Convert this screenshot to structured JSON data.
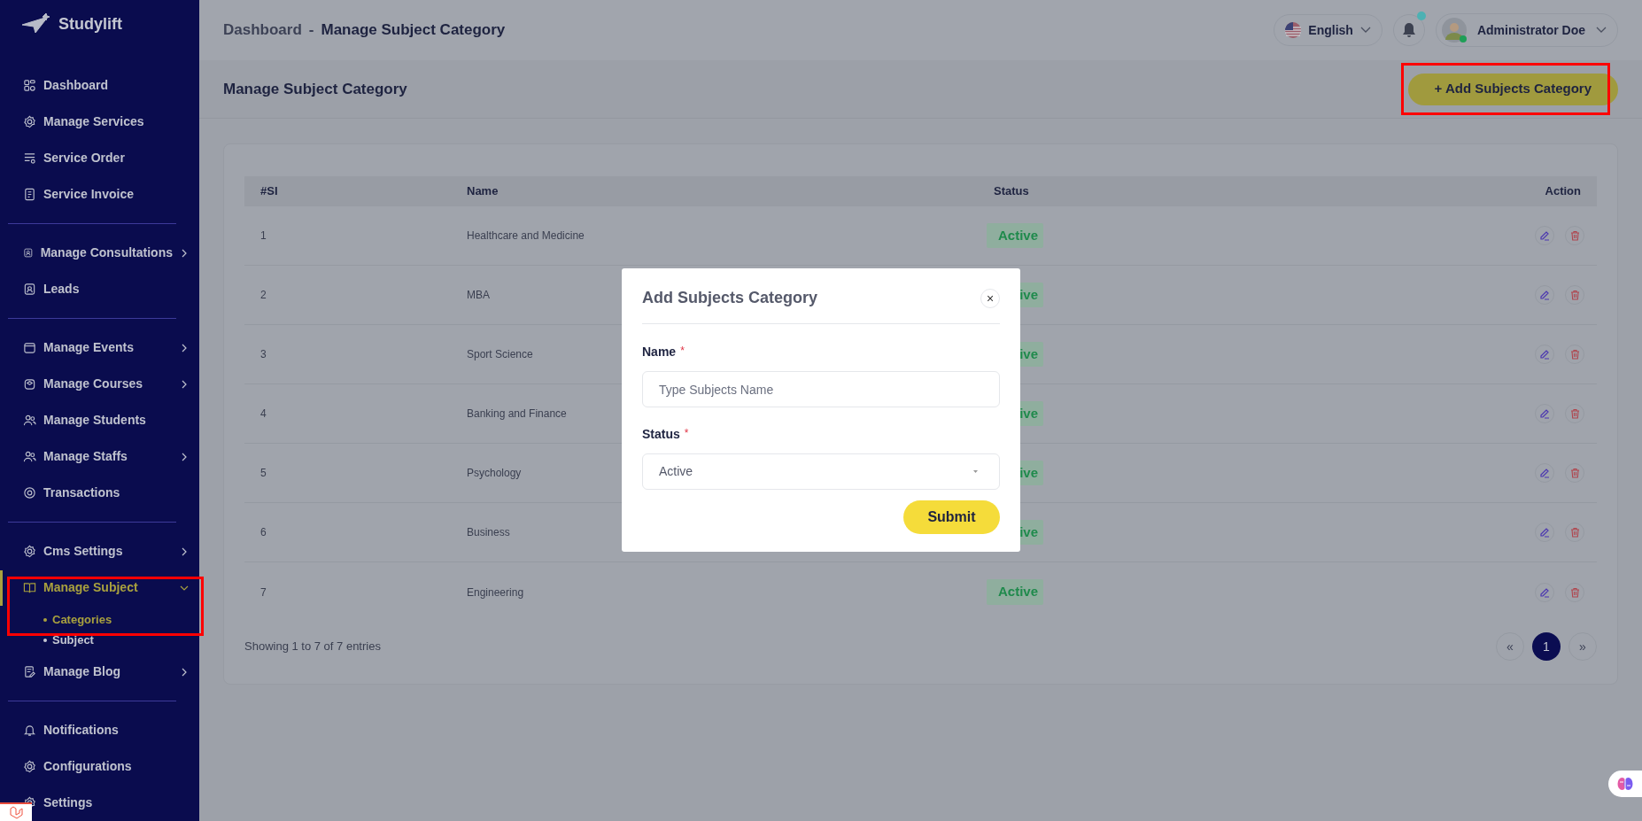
{
  "brand": "Studylift",
  "sidebar": {
    "sections": [
      {
        "items": [
          {
            "label": "Dashboard",
            "selected": false
          },
          {
            "label": "Manage Services",
            "selected": false
          },
          {
            "label": "Service Order",
            "selected": false
          },
          {
            "label": "Service Invoice",
            "selected": false
          }
        ]
      },
      {
        "items": [
          {
            "label": "Manage Consultations",
            "expanded": false,
            "selected": false
          },
          {
            "label": "Leads",
            "selected": false
          }
        ]
      },
      {
        "items": [
          {
            "label": "Manage Events",
            "expanded": false,
            "selected": false
          },
          {
            "label": "Manage Courses",
            "expanded": false,
            "selected": false
          },
          {
            "label": "Manage Students",
            "selected": false
          },
          {
            "label": "Manage Staffs",
            "expanded": false,
            "selected": false
          },
          {
            "label": "Transactions",
            "selected": false
          }
        ]
      },
      {
        "items": [
          {
            "label": "Cms Settings",
            "expanded": false,
            "selected": false
          },
          {
            "label": "Manage Subject",
            "expanded": true,
            "selected": true,
            "children": [
              {
                "label": "Categories",
                "selected": true
              },
              {
                "label": "Subject",
                "selected": false
              }
            ]
          },
          {
            "label": "Manage Blog",
            "expanded": false,
            "selected": false
          }
        ]
      },
      {
        "items": [
          {
            "label": "Notifications",
            "selected": false
          },
          {
            "label": "Configurations",
            "selected": false
          },
          {
            "label": "Settings",
            "selected": false
          }
        ]
      }
    ]
  },
  "header": {
    "breadcrumb": [
      "Dashboard",
      "-",
      "Manage Subject Category"
    ],
    "language": "English",
    "user": "Administrator Doe",
    "notification_dot": true,
    "online": true
  },
  "page_title": "Manage Subject Category",
  "add_button": "+ Add Subjects Category",
  "table": {
    "columns": [
      "#SI",
      "Name",
      "Status",
      "Action"
    ],
    "rows": [
      {
        "si": "1",
        "name": "Healthcare and Medicine",
        "status": "Active"
      },
      {
        "si": "2",
        "name": "MBA",
        "status": "ive"
      },
      {
        "si": "3",
        "name": "Sport Science",
        "status": "ive"
      },
      {
        "si": "4",
        "name": "Banking and Finance",
        "status": "ive"
      },
      {
        "si": "5",
        "name": "Psychology",
        "status": "ive"
      },
      {
        "si": "6",
        "name": "Business",
        "status": "ive"
      },
      {
        "si": "7",
        "name": "Engineering",
        "status": "Active"
      }
    ]
  },
  "footer": {
    "info": "Showing 1 to 7 of 7 entries",
    "pages": [
      {
        "label": "«",
        "selected": false
      },
      {
        "label": "1",
        "selected": true
      },
      {
        "label": "»",
        "selected": false
      }
    ]
  },
  "modal": {
    "title": "Add Subjects Category",
    "close": "×",
    "fields": [
      {
        "kind": "text",
        "label": "Name",
        "required": "*",
        "placeholder": "Type Subjects Name"
      },
      {
        "kind": "select",
        "label": "Status",
        "required": "*",
        "value": "Active"
      }
    ],
    "submit": "Submit"
  }
}
